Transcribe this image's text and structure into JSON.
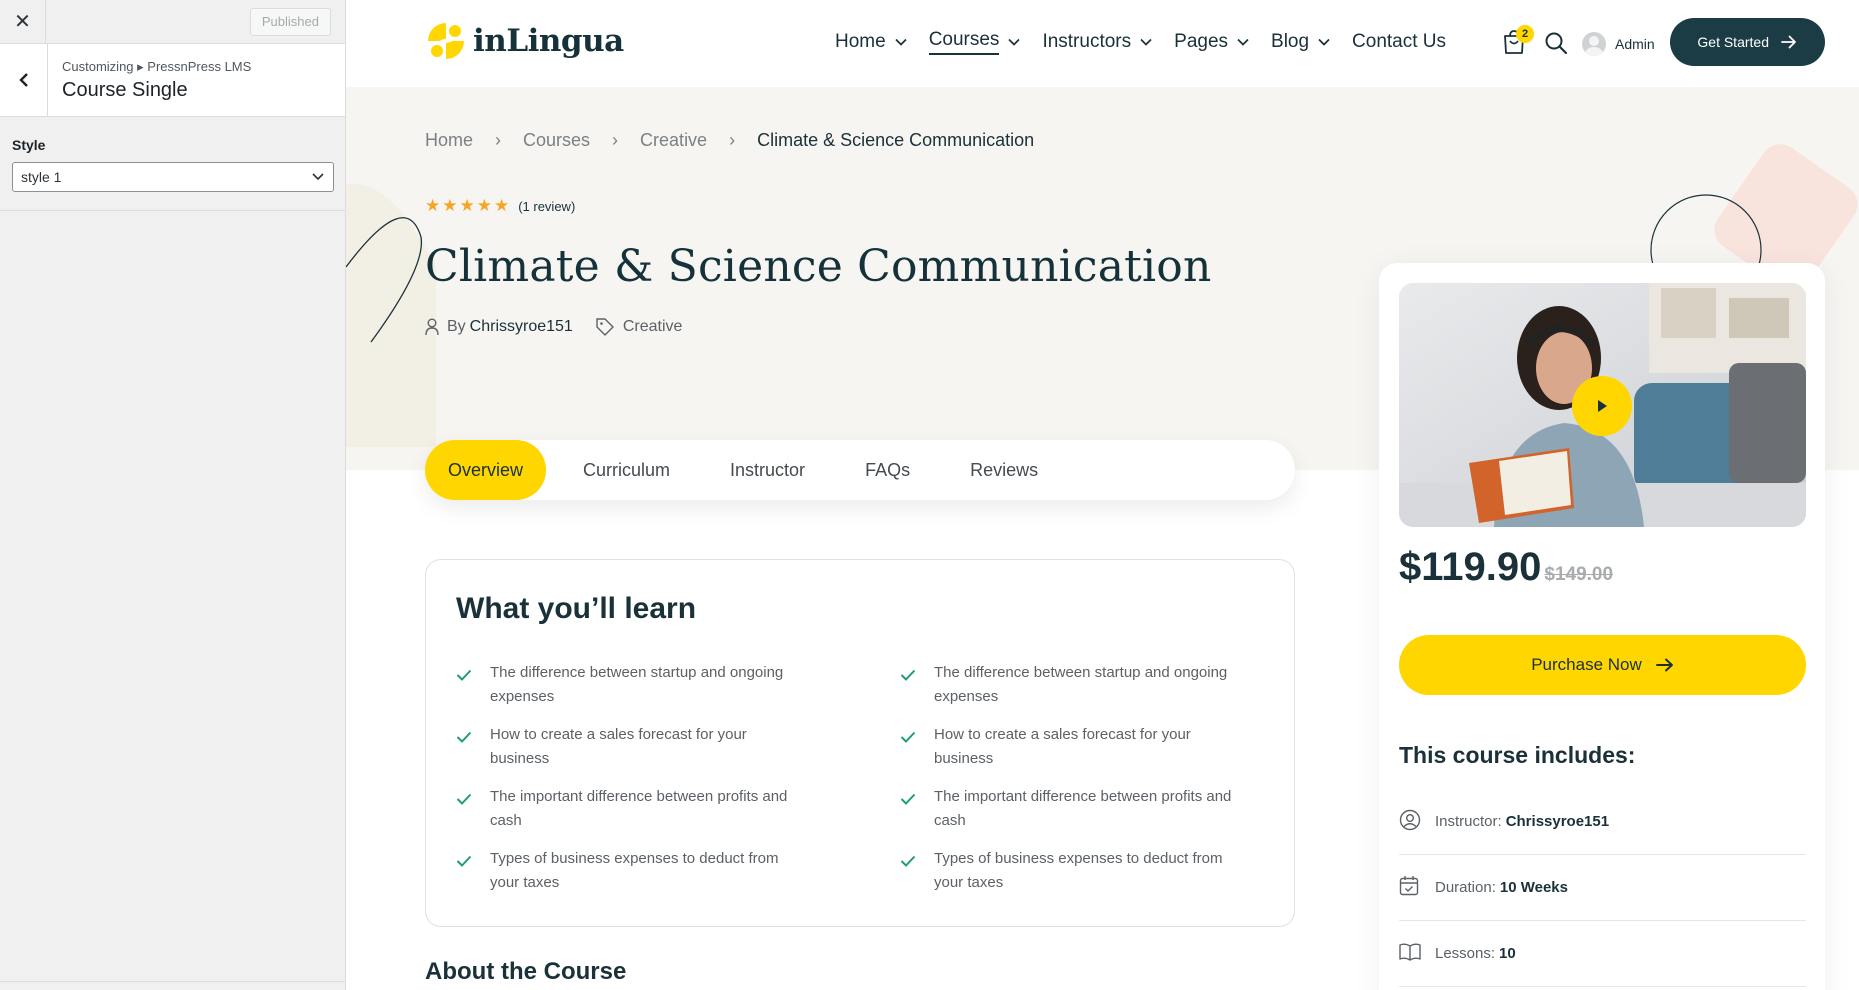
{
  "customizer": {
    "close_label": "✕",
    "published_label": "Published",
    "breadcrumb": "Customizing ▸ PressnPress LMS",
    "section_title": "Course Single",
    "style_label": "Style",
    "style_value": "style 1"
  },
  "header": {
    "logo_text": "inLingua",
    "nav": [
      {
        "label": "Home",
        "has_dropdown": true
      },
      {
        "label": "Courses",
        "has_dropdown": true,
        "active": true
      },
      {
        "label": "Instructors",
        "has_dropdown": true
      },
      {
        "label": "Pages",
        "has_dropdown": true
      },
      {
        "label": "Blog",
        "has_dropdown": true
      },
      {
        "label": "Contact Us",
        "has_dropdown": false
      }
    ],
    "cart_count": "2",
    "user_name": "Admin",
    "cta_label": "Get Started"
  },
  "breadcrumb": [
    "Home",
    "Courses",
    "Creative",
    "Climate & Science Communication"
  ],
  "course": {
    "rating_stars": "★★★★★",
    "review_count": "(1 review)",
    "title": "Climate & Science Communication",
    "by_label": "By",
    "author": "Chrissyroe151",
    "category": "Creative"
  },
  "tabs": [
    "Overview",
    "Curriculum",
    "Instructor",
    "FAQs",
    "Reviews"
  ],
  "learn": {
    "title": "What you’ll learn",
    "left": [
      "The difference between startup and ongoing expenses",
      "How to create a sales forecast for your business",
      "The important difference between profits and cash",
      "Types of business expenses to deduct from your taxes"
    ],
    "right": [
      "The difference between startup and ongoing expenses",
      "How to create a sales forecast for your business",
      "The important difference between profits and cash",
      "Types of business expenses to deduct from your taxes"
    ]
  },
  "about_title": "About the Course",
  "sidebar": {
    "price_now": "$119.90",
    "price_old": "$149.00",
    "purchase_label": "Purchase Now",
    "includes_title": "This course includes:",
    "includes": [
      {
        "icon": "user-circle-icon",
        "label": "Instructor:",
        "value": "Chrissyroe151"
      },
      {
        "icon": "calendar-icon",
        "label": "Duration:",
        "value": "10 Weeks"
      },
      {
        "icon": "book-icon",
        "label": "Lessons:",
        "value": "10"
      }
    ]
  },
  "colors": {
    "accent": "#ffd600",
    "dark": "#1b3c45",
    "hero_bg": "#f6f5f2",
    "check": "#1e9b7b"
  }
}
